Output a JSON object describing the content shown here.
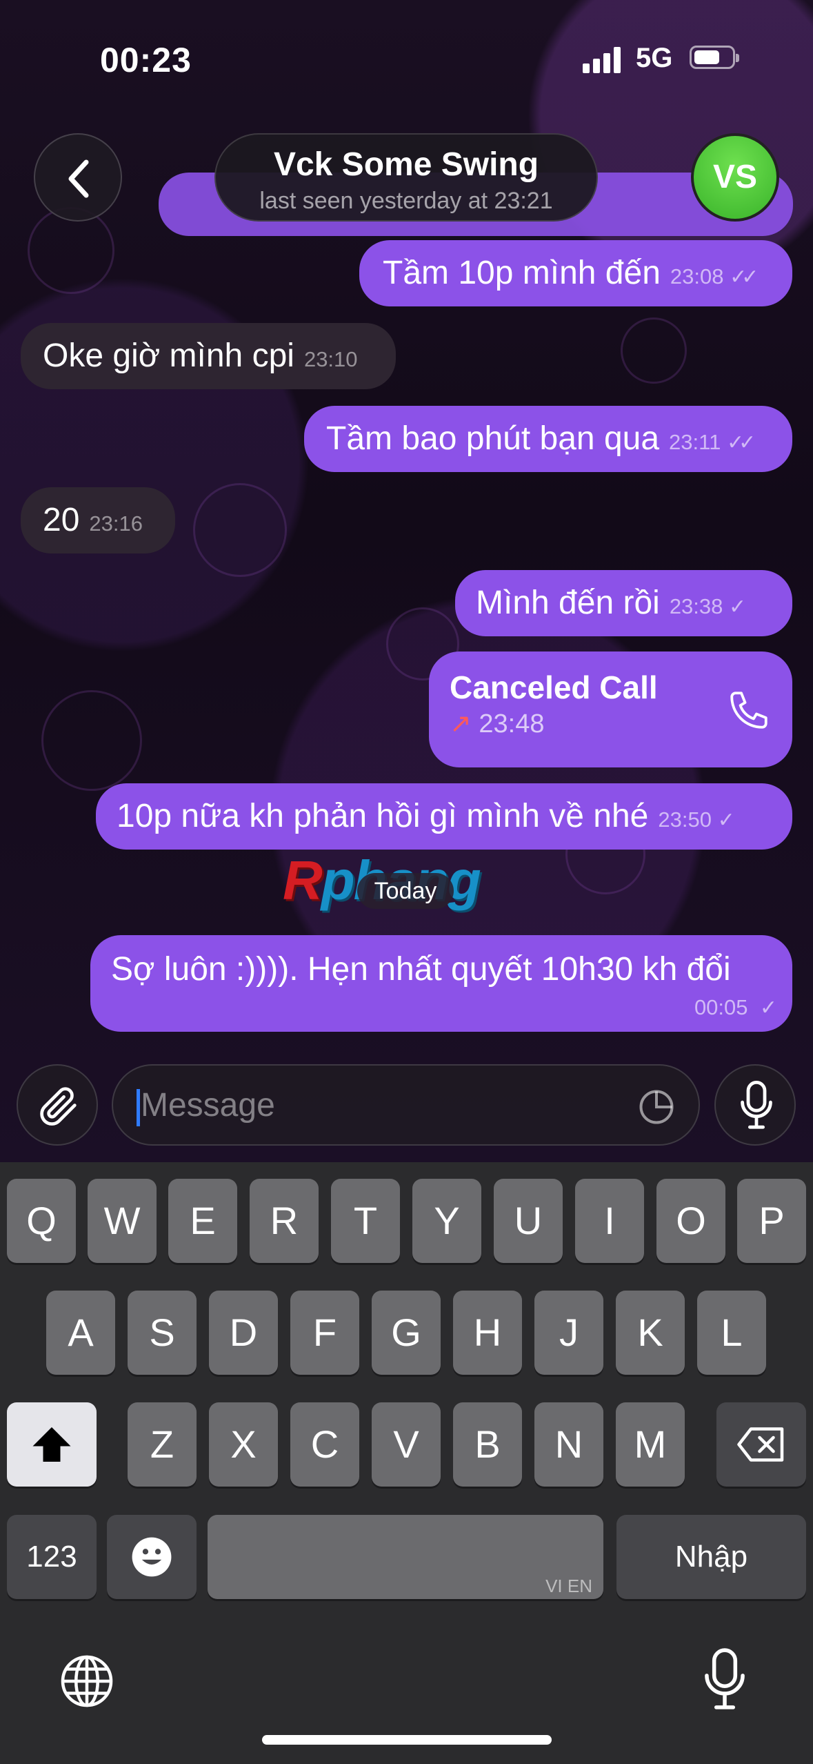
{
  "status_bar": {
    "time": "00:23",
    "network": "5G"
  },
  "header": {
    "contact_name": "Vck Some Swing",
    "last_seen": "last seen yesterday at 23:21",
    "avatar_initials": "VS",
    "avatar_color": "#4fcb3a"
  },
  "messages": [
    {
      "id": "m1",
      "dir": "out",
      "text": "Tầm 10p mình đến",
      "time": "23:08",
      "ticks": "✓✓"
    },
    {
      "id": "m2",
      "dir": "in",
      "text": "Oke giờ mình cpi",
      "time": "23:10"
    },
    {
      "id": "m3",
      "dir": "out",
      "text": "Tầm bao phút bạn qua",
      "time": "23:11",
      "ticks": "✓✓"
    },
    {
      "id": "m4",
      "dir": "in",
      "text": "20",
      "time": "23:16"
    },
    {
      "id": "m5",
      "dir": "out",
      "text": "Mình đến rồi",
      "time": "23:38",
      "ticks": "✓"
    },
    {
      "id": "m6",
      "dir": "out",
      "type": "call",
      "text": "Canceled Call",
      "time": "23:48"
    },
    {
      "id": "m7",
      "dir": "out",
      "text": "10p nữa kh phản hồi gì mình về nhé",
      "time": "23:50",
      "ticks": "✓"
    },
    {
      "id": "m8",
      "dir": "out",
      "text": "Sợ luôn :)))). Hẹn nhất quyết 10h30 kh đổi",
      "time": "00:05",
      "ticks": "✓"
    }
  ],
  "date_separator": "Today",
  "watermark": {
    "letter": "R",
    "rest": "phang"
  },
  "composer": {
    "placeholder": "Message"
  },
  "keyboard": {
    "row1": [
      "Q",
      "W",
      "E",
      "R",
      "T",
      "Y",
      "U",
      "I",
      "O",
      "P"
    ],
    "row2": [
      "A",
      "S",
      "D",
      "F",
      "G",
      "H",
      "J",
      "K",
      "L"
    ],
    "row3": [
      "Z",
      "X",
      "C",
      "V",
      "B",
      "N",
      "M"
    ],
    "numbers_label": "123",
    "space_hint": "VI EN",
    "return_label": "Nhập"
  },
  "colors": {
    "outgoing_bubble": "#8c52e8",
    "incoming_bubble": "#2e2531",
    "keyboard_bg": "#2b2b2d"
  }
}
